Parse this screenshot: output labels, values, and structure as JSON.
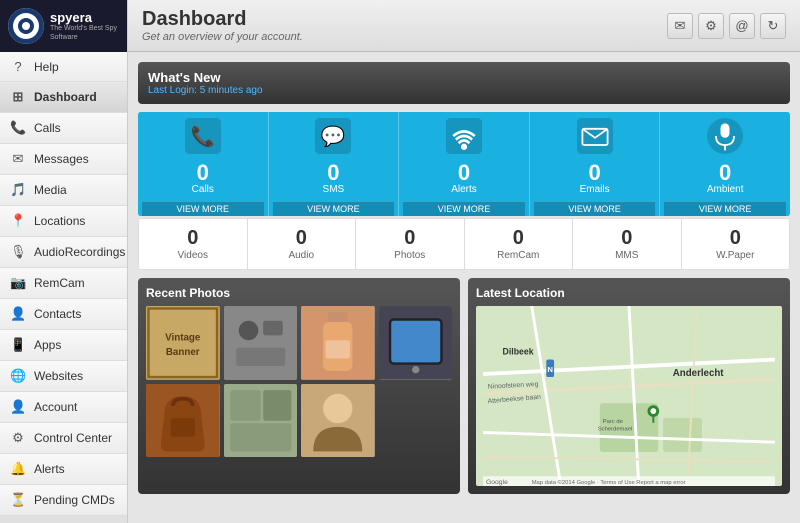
{
  "logo": {
    "name": "spyera",
    "tagline": "The World's Best Spy Software"
  },
  "sidebar": {
    "items": [
      {
        "id": "help",
        "label": "Help",
        "icon": "?"
      },
      {
        "id": "dashboard",
        "label": "Dashboard",
        "icon": "⊞",
        "active": true
      },
      {
        "id": "calls",
        "label": "Calls",
        "icon": "📞"
      },
      {
        "id": "messages",
        "label": "Messages",
        "icon": "✉"
      },
      {
        "id": "media",
        "label": "Media",
        "icon": "🎵"
      },
      {
        "id": "locations",
        "label": "Locations",
        "icon": "📍"
      },
      {
        "id": "audiorecordings",
        "label": "AudioRecordings",
        "icon": "🎙"
      },
      {
        "id": "remcam",
        "label": "RemCam",
        "icon": "📷"
      },
      {
        "id": "contacts",
        "label": "Contacts",
        "icon": "👤"
      },
      {
        "id": "apps",
        "label": "Apps",
        "icon": "📱"
      },
      {
        "id": "websites",
        "label": "Websites",
        "icon": "🌐"
      },
      {
        "id": "account",
        "label": "Account",
        "icon": "👤"
      },
      {
        "id": "controlcenter",
        "label": "Control Center",
        "icon": "⚙"
      },
      {
        "id": "alerts",
        "label": "Alerts",
        "icon": "🔔"
      },
      {
        "id": "pendingcmds",
        "label": "Pending CMDs",
        "icon": "⏳"
      }
    ]
  },
  "header": {
    "title": "Dashboard",
    "subtitle": "Get an overview of your account.",
    "icons": [
      "email-icon",
      "gear-icon",
      "at-icon",
      "refresh-icon"
    ]
  },
  "whats_new": {
    "title": "What's New",
    "last_login_label": "Last Login:",
    "last_login_time": "5 minutes ago"
  },
  "stats": [
    {
      "id": "calls",
      "label": "Calls",
      "value": "0",
      "view_more": "VIEW MORE",
      "icon_type": "phone"
    },
    {
      "id": "sms",
      "label": "SMS",
      "value": "0",
      "view_more": "VIEW MORE",
      "icon_type": "sms"
    },
    {
      "id": "alerts",
      "label": "Alerts",
      "value": "0",
      "view_more": "VIEW MORE",
      "icon_type": "wifi"
    },
    {
      "id": "emails",
      "label": "Emails",
      "value": "0",
      "view_more": "VIEW MORE",
      "icon_type": "email"
    },
    {
      "id": "ambient",
      "label": "Ambient",
      "value": "0",
      "view_more": "VIEW MORE",
      "icon_type": "mic"
    }
  ],
  "secondary_stats": [
    {
      "id": "videos",
      "label": "Videos",
      "value": "0"
    },
    {
      "id": "audio",
      "label": "Audio",
      "value": "0"
    },
    {
      "id": "photos",
      "label": "Photos",
      "value": "0"
    },
    {
      "id": "remcam",
      "label": "RemCam",
      "value": "0"
    },
    {
      "id": "mms",
      "label": "MMS",
      "value": "0"
    },
    {
      "id": "wpaper",
      "label": "W.Paper",
      "value": "0"
    }
  ],
  "recent_photos": {
    "title": "Recent Photos",
    "photos": [
      {
        "id": 1,
        "color": "#8b7355",
        "label": "Vintage Banner"
      },
      {
        "id": 2,
        "color": "#6b6b6b",
        "label": "misc"
      },
      {
        "id": 3,
        "color": "#c8906e",
        "label": "bottle"
      },
      {
        "id": 4,
        "color": "#555577",
        "label": "tablet"
      },
      {
        "id": 5,
        "color": "#8b4513",
        "label": "bag"
      },
      {
        "id": 6,
        "color": "#7b8b6b",
        "label": "items"
      },
      {
        "id": 7,
        "color": "#c8a878",
        "label": "portrait"
      }
    ]
  },
  "latest_location": {
    "title": "Latest Location",
    "location_name": "Anderlecht",
    "map_labels": [
      "Dilbeek",
      "Anderlecht",
      "Ninoofsteen weg",
      "Atterbeekse baan"
    ],
    "footer_left": "Google",
    "footer_right": "Map data ©2014 Google · Terms of Use  Report a map error"
  }
}
